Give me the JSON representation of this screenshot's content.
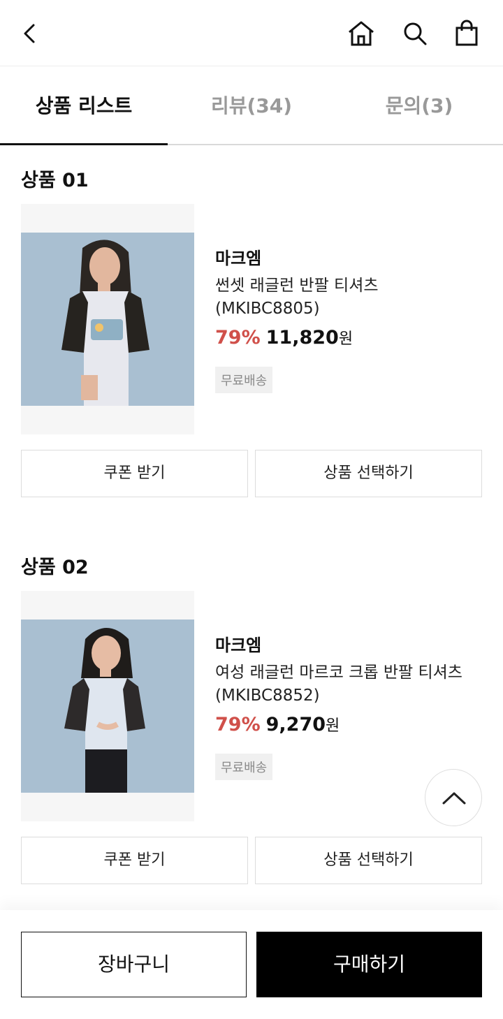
{
  "tabs": [
    {
      "label": "상품 리스트"
    },
    {
      "label": "리뷰(34)"
    },
    {
      "label": "문의(3)"
    }
  ],
  "products": [
    {
      "section_title": "상품 01",
      "brand": "마크엠",
      "name_line1": "썬셋 래글런 반팔 티셔츠",
      "name_line2": "(MKIBC8805)",
      "discount": "79%",
      "price": "11,820",
      "currency": "원",
      "badge": "무료배송",
      "coupon_label": "쿠폰 받기",
      "select_label": "상품 선택하기"
    },
    {
      "section_title": "상품 02",
      "brand": "마크엠",
      "name_line1": "여성 래글런 마르코 크롭 반팔 티셔츠",
      "name_line2": "(MKIBC8852)",
      "discount": "79%",
      "price": "9,270",
      "currency": "원",
      "badge": "무료배송",
      "coupon_label": "쿠폰 받기",
      "select_label": "상품 선택하기"
    }
  ],
  "bottom": {
    "cart_label": "장바구니",
    "buy_label": "구매하기"
  },
  "colors": {
    "discount": "#d0504a",
    "thumb_bg": "#a9bfd1",
    "primary": "#000000"
  },
  "icons": [
    "back-icon",
    "home-icon",
    "search-icon",
    "shopping-bag-icon",
    "chevron-up-icon"
  ]
}
